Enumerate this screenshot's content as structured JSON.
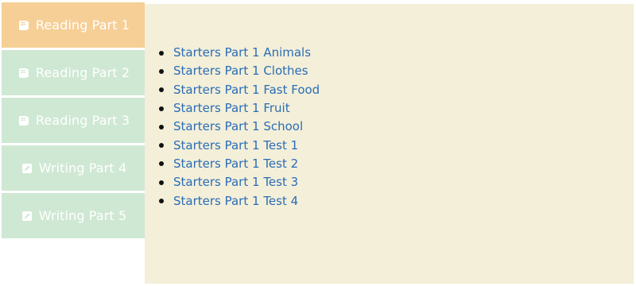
{
  "tabs": [
    {
      "label": "Reading Part 1",
      "icon": "book-icon",
      "active": true
    },
    {
      "label": "Reading Part 2",
      "icon": "book-icon",
      "active": false
    },
    {
      "label": "Reading Part 3",
      "icon": "book-icon",
      "active": false
    },
    {
      "label": "Writing Part 4",
      "icon": "pencil-icon",
      "active": false
    },
    {
      "label": "Writing Part 5",
      "icon": "pencil-icon",
      "active": false
    }
  ],
  "links": [
    "Starters Part 1 Animals",
    "Starters Part 1 Clothes",
    "Starters Part 1 Fast Food",
    "Starters Part 1 Fruit",
    "Starters Part 1 School",
    "Starters Part 1 Test 1",
    "Starters Part 1 Test 2",
    "Starters Part 1 Test 3",
    "Starters Part 1 Test 4"
  ],
  "colors": {
    "active_tab": "#f6cf96",
    "inactive_tab": "#cfe8d3",
    "panel_bg": "#f4efd9",
    "link": "#2a6db5",
    "tab_text": "#ffffff"
  }
}
